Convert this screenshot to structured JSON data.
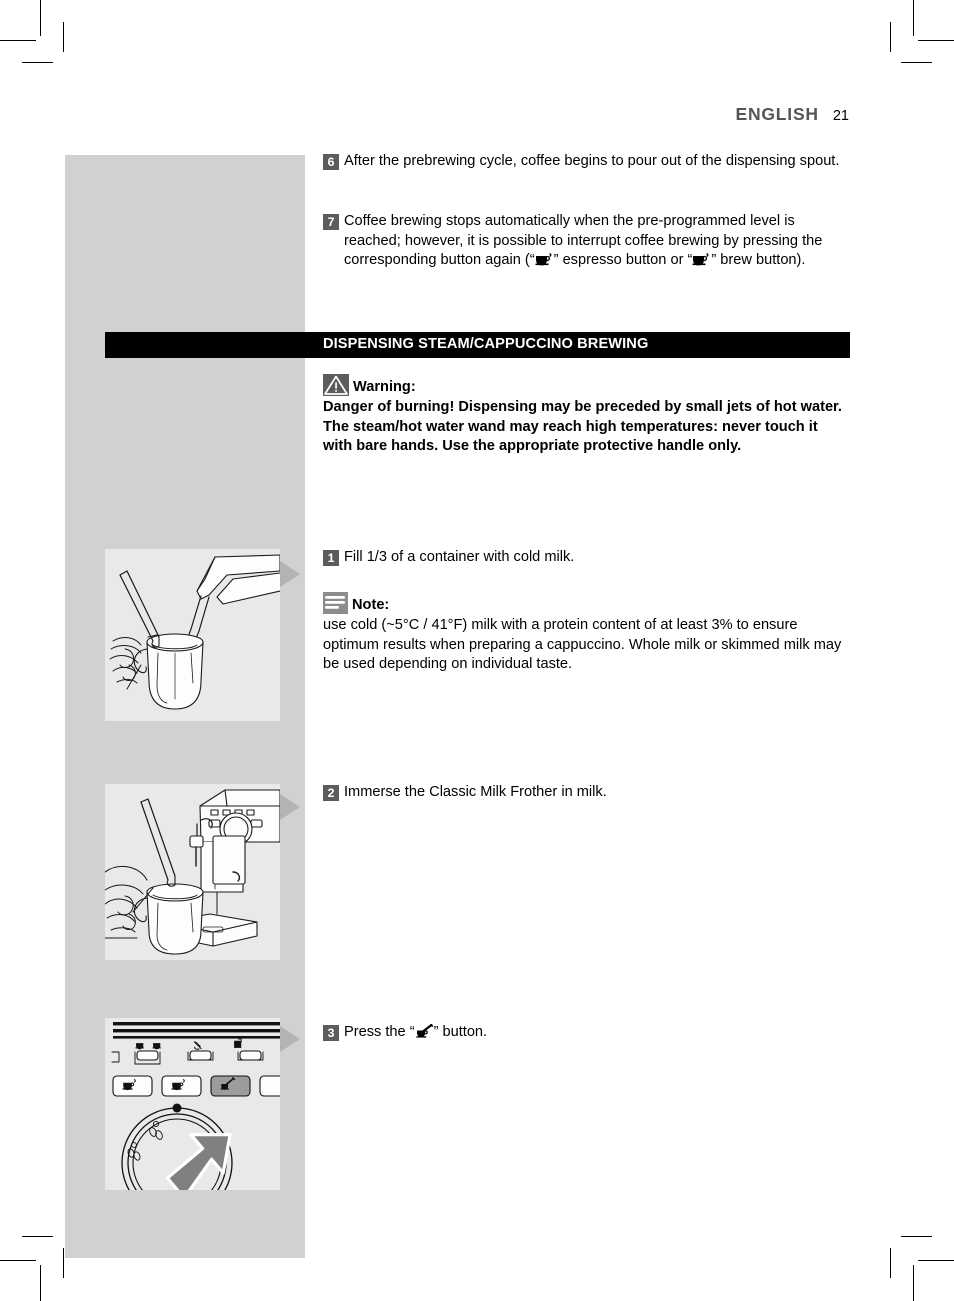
{
  "header": {
    "language": "ENGLISH",
    "page_number": "21"
  },
  "steps_top": [
    {
      "number": "6",
      "text": "After the prebrewing cycle, coffee begins to pour out of the dispensing spout."
    }
  ],
  "step7": {
    "number": "7",
    "part1": "Coffee brewing stops automatically when the pre-programmed level is reached; however, it is possible to interrupt coffee brewing by pressing the corresponding button again (“",
    "part2": "” espresso button or “",
    "part3": "” brew button).",
    "icon1": "espresso-cup-icon",
    "icon2": "brew-cup-icon"
  },
  "section": {
    "title": "DISPENSING STEAM/CAPPUCCINO BREWING"
  },
  "warning": {
    "icon": "warning-triangle-icon",
    "label": "Warning:",
    "body": "Danger of burning! Dispensing may be preceded by small jets of hot water. The steam/hot water wand may reach high temperatures: never touch it with bare hands. Use the appropriate protective handle only."
  },
  "step1": {
    "number": "1",
    "text": "Fill 1/3 of a container with cold milk."
  },
  "note": {
    "icon": "note-lines-icon",
    "label": "Note:",
    "body": "use cold (~5°C / 41°F) milk with a protein content of at least 3% to ensure optimum results when preparing a cappuccino. Whole milk or skimmed milk may be used depending on individual taste."
  },
  "step2": {
    "number": "2",
    "text": "Immerse the Classic Milk Frother in milk."
  },
  "step3": {
    "number": "3",
    "part1": "Press the “",
    "part2": "” button.",
    "icon": "steam-wand-icon"
  },
  "illustrations": [
    {
      "name": "pour-milk-into-jug-illustration",
      "caption_ref": "1"
    },
    {
      "name": "immerse-frother-in-milk-illustration",
      "caption_ref": "2"
    },
    {
      "name": "press-steam-button-illustration",
      "caption_ref": "3"
    }
  ],
  "colors": {
    "panel_gray": "#d1d1d1",
    "illustration_bg": "#e9e9e9",
    "step_badge": "#5c5c5c",
    "note_icon": "#8c8c8c",
    "section_bar": "#000000",
    "header_gray": "#555555",
    "pointer_gray": "#b3b3b3",
    "arrow_gray": "#808080"
  }
}
